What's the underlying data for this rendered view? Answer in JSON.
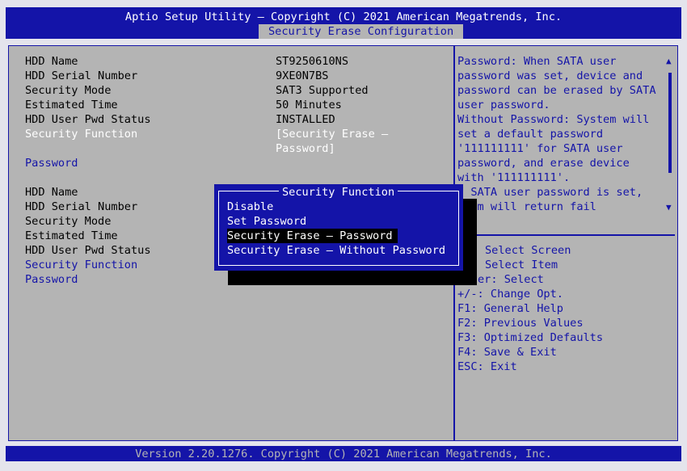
{
  "header": {
    "title": "Aptio Setup Utility – Copyright (C) 2021 American Megatrends, Inc.",
    "active_tab": "Security Erase Configuration"
  },
  "drives": [
    {
      "rows": [
        {
          "label": "HDD Name",
          "value": "ST9250610NS"
        },
        {
          "label": "HDD Serial Number",
          "value": "9XE0N7BS"
        },
        {
          "label": "Security Mode",
          "value": "SAT3 Supported"
        },
        {
          "label": "Estimated Time",
          "value": "50 Minutes"
        },
        {
          "label": "HDD User Pwd Status",
          "value": "INSTALLED"
        }
      ],
      "security_function": {
        "label": "Security Function",
        "value_line1": "[Security Erase –",
        "value_line2": "Password]"
      },
      "password": {
        "label": "Password"
      }
    },
    {
      "rows": [
        {
          "label": "HDD Name"
        },
        {
          "label": "HDD Serial Number"
        },
        {
          "label": "Security Mode"
        },
        {
          "label": "Estimated Time"
        },
        {
          "label": "HDD User Pwd Status"
        }
      ],
      "security_function": {
        "label": "Security Function"
      },
      "password": {
        "label": "Password"
      }
    }
  ],
  "help_text": [
    "Password: When SATA user",
    "password was set, device and",
    "password can be erased by SATA",
    "user password.",
    "Without Password: System will",
    "set a default password",
    "'111111111' for SATA user",
    "password, and erase device",
    "with '111111111'.",
    "f SATA user password is set,",
    "stem will return fail"
  ],
  "key_help": [
    "Select Screen",
    "Select Item",
    "er: Select",
    "+/-: Change Opt.",
    "F1: General Help",
    "F2: Previous Values",
    "F3: Optimized Defaults",
    "F4: Save & Exit",
    "ESC: Exit"
  ],
  "popup": {
    "title": "Security Function",
    "options": [
      {
        "label": "Disable",
        "selected": false
      },
      {
        "label": "Set Password",
        "selected": false
      },
      {
        "label": "Security Erase – Password",
        "selected": true
      },
      {
        "label": "Security Erase – Without Password",
        "selected": false
      }
    ]
  },
  "footer": {
    "text": "Version 2.20.1276. Copyright (C) 2021 American Megatrends, Inc."
  },
  "icons": {
    "scroll_up": "scroll-up-arrow-icon",
    "scroll_down": "scroll-down-arrow-icon"
  },
  "colors": {
    "bios_blue": "#1414a8",
    "panel_gray": "#b4b4b4",
    "highlight_white": "#ffffff",
    "selection_black": "#000000"
  }
}
